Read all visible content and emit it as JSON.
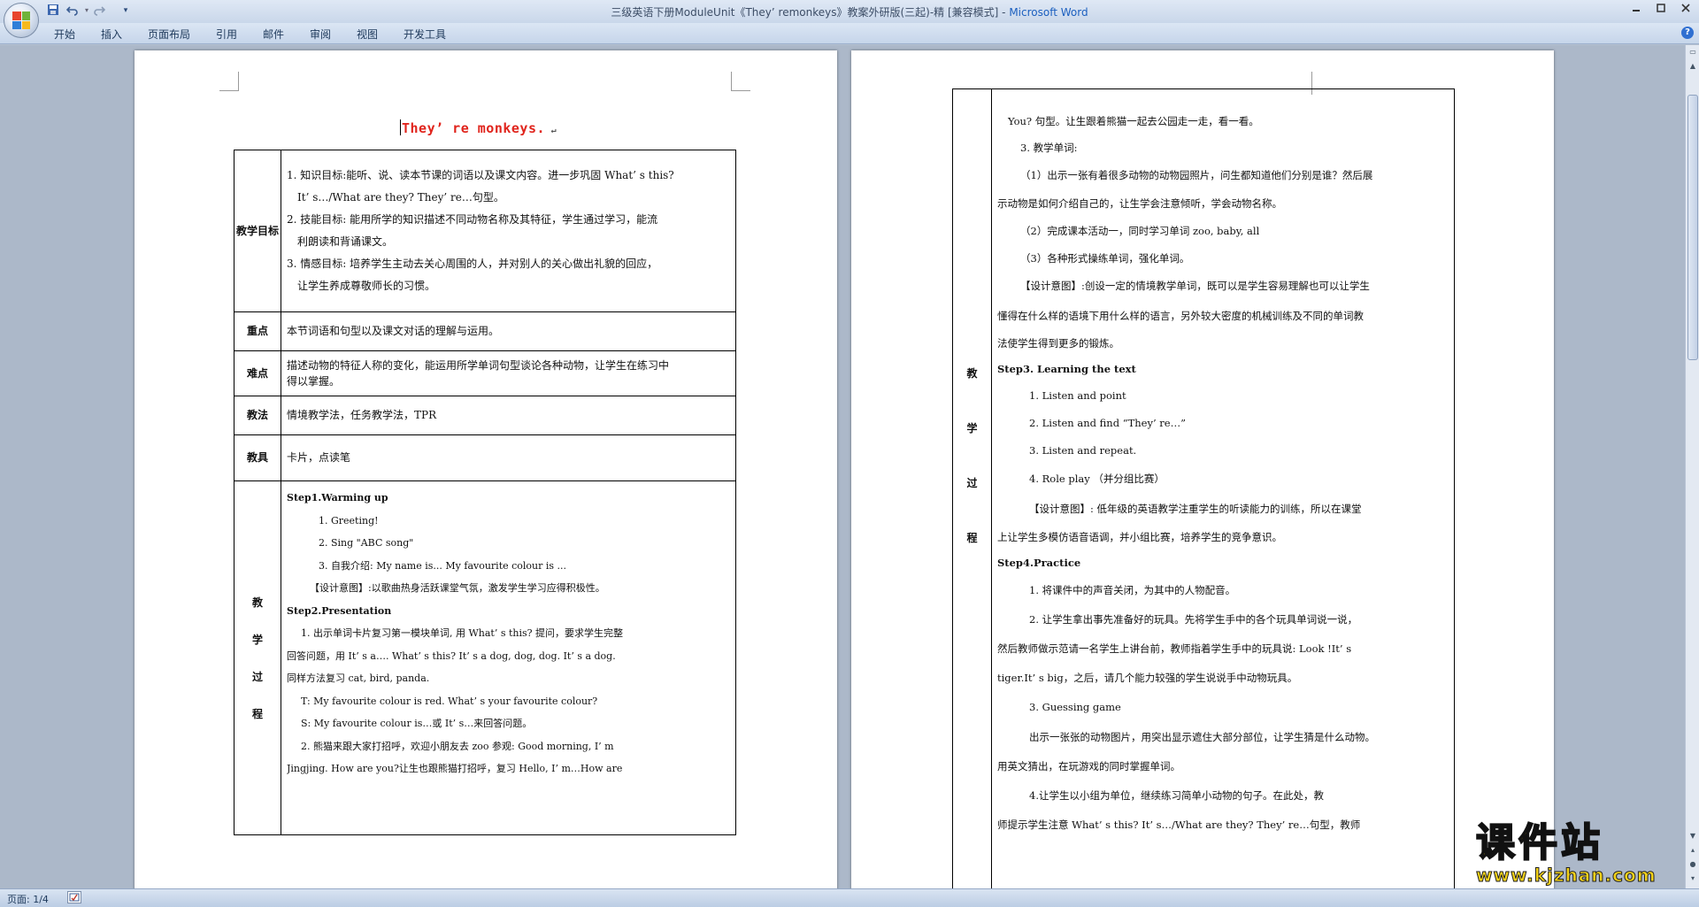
{
  "window": {
    "title_doc": "三级英语下册ModuleUnit《They’ remonkeys》教案外研版(三起)-精 [兼容模式]",
    "title_sep": " - ",
    "title_app": "Microsoft Word"
  },
  "quick_access": {
    "save": "save-icon",
    "undo": "undo-icon",
    "redo": "redo-icon",
    "more": "▾"
  },
  "ribbon": {
    "tabs": [
      "开始",
      "插入",
      "页面布局",
      "引用",
      "邮件",
      "审阅",
      "视图",
      "开发工具"
    ]
  },
  "status": {
    "page": "页面: 1/4"
  },
  "colors": {
    "title_red": "#e0241c",
    "watermark": "#f3d219",
    "accent": "#1b5fbf"
  },
  "page1": {
    "title": "They’ re monkeys.",
    "rows": [
      {
        "label": "教学目标",
        "lines": [
          "1. 知识目标:能听、说、读本节课的词语以及课文内容。进一步巩固 What’ s this?",
          "It’ s…/What are they? They’ re…句型。",
          "2. 技能目标: 能用所学的知识描述不同动物名称及其特征，学生通过学习，能流",
          "利朗读和背诵课文。",
          "3. 情感目标: 培养学生主动去关心周围的人，并对别人的关心做出礼貌的回应，",
          "让学生养成尊敬师长的习惯。"
        ]
      },
      {
        "label": "重点",
        "lines": [
          "本节词语和句型以及课文对话的理解与运用。"
        ]
      },
      {
        "label": "难点",
        "lines": [
          "描述动物的特征人称的变化，能运用所学单词句型谈论各种动物，让学生在练习中",
          "得以掌握。"
        ]
      },
      {
        "label": "教法",
        "lines": [
          "情境教学法，任务教学法，TPR"
        ]
      },
      {
        "label": "教具",
        "lines": [
          "卡片，点读笔"
        ]
      }
    ],
    "process_label": "教学过程",
    "process_lines": [
      "Step1.Warming up",
      "1. Greeting!",
      "2. Sing \"ABC song\"",
      "3. 自我介绍: My name is... My favourite colour is ...",
      "【设计意图】:以歌曲热身活跃课堂气氛，激发学生学习应得积极性。",
      "Step2.Presentation",
      "1. 出示单词卡片复习第一模块单词, 用 What’ s this? 提问，要求学生完整",
      "回答问题，用 It’ s a…. What’ s this? It’ s a dog, dog, dog. It’ s a dog.",
      "同样方法复习 cat, bird, panda.",
      "T: My favourite colour is red. What’ s your favourite colour?",
      "S: My favourite colour is…或 It’ s…来回答问题。",
      "2. 熊猫来跟大家打招呼，欢迎小朋友去 zoo 参观: Good morning, I’ m",
      "Jingjing. How are you?让生也跟熊猫打招呼，复习 Hello, I’ m…How are"
    ]
  },
  "page2": {
    "process_label": "教学过程",
    "lines": [
      "You? 句型。让生跟着熊猫一起去公园走一走，看一看。",
      "3. 教学单词:",
      "（1）出示一张有着很多动物的动物园照片，问生都知道他们分别是谁？然后展",
      "示动物是如何介绍自己的，让生学会注意倾听，学会动物名称。",
      "（2）完成课本活动一，同时学习单词 zoo, baby, all",
      "（3）各种形式操练单词，强化单词。",
      "【设计意图】:创设一定的情境教学单词，既可以是学生容易理解也可以让学生",
      "懂得在什么样的语境下用什么样的语言，另外较大密度的机械训练及不同的单词教",
      "法使学生得到更多的锻炼。",
      "Step3. Learning the text",
      "1. Listen and point",
      "2. Listen and find “They’ re…”",
      "3. Listen and repeat.",
      "4. Role play （并分组比赛）",
      "【设计意图】: 低年级的英语教学注重学生的听读能力的训练，所以在课堂",
      "上让学生多模仿语音语调，并小组比赛，培养学生的竞争意识。",
      "Step4.Practice",
      "1. 将课件中的声音关闭，为其中的人物配音。",
      "2. 让学生拿出事先准备好的玩具。先将学生手中的各个玩具单词说一说，",
      "然后教师做示范请一名学生上讲台前，教师指着学生手中的玩具说: Look !It’ s",
      "tiger.It’ s big，之后，请几个能力较强的学生说说手中动物玩具。",
      "3. Guessing game",
      "出示一张张的动物图片，用突出显示遮住大部分部位，让学生猜是什么动物。",
      "用英文猜出，在玩游戏的同时掌握单词。",
      "4.让学生以小组为单位，继续练习简单小动物的句子。在此处，教",
      "师提示学生注意 What’ s this? It’ s…/What are they? They’ re…句型，教师"
    ]
  },
  "watermark": {
    "text": "课件站",
    "url": "www.kjzhan.com"
  }
}
